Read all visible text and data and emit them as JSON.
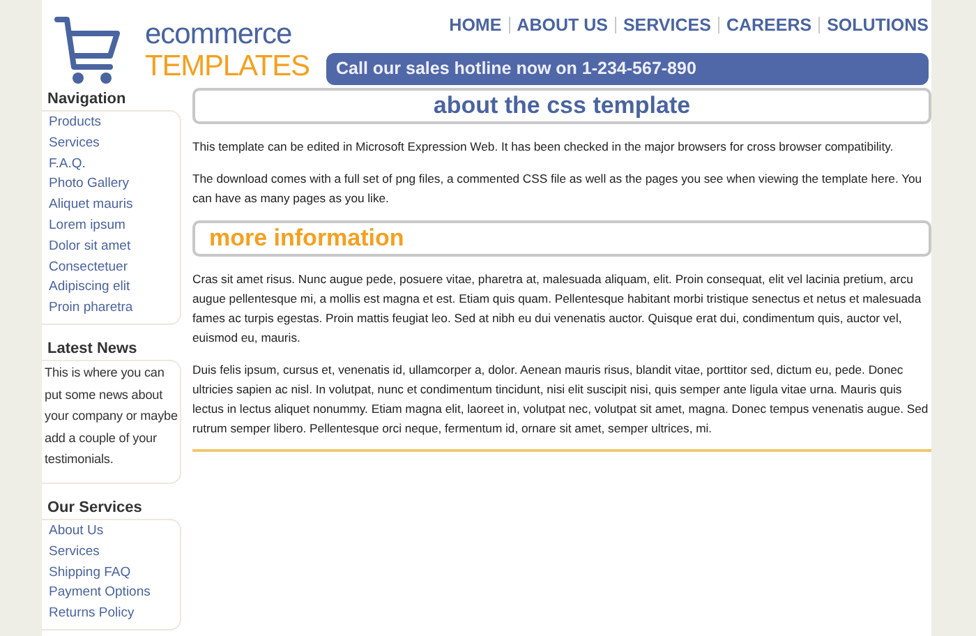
{
  "logo": {
    "line_1": "ecommerce",
    "line_2": "TEMPLATES"
  },
  "top_nav": [
    "HOME",
    "ABOUT US",
    "SERVICES",
    "CAREERS",
    "SOLUTIONS"
  ],
  "hotline": "Call our sales hotline now on 1-234-567-890",
  "sidebar": [
    {
      "kind": "links",
      "title": "Navigation",
      "items": [
        "Products",
        "Services",
        "F.A.Q.",
        "Photo Gallery",
        "Aliquet mauris",
        "Lorem ipsum",
        "Dolor sit amet",
        "Consectetuer",
        "Adipiscing elit",
        "Proin pharetra"
      ]
    },
    {
      "kind": "text",
      "title": "Latest News",
      "text": "This is where you can put some news about your company or maybe add a couple of your testimonials."
    },
    {
      "kind": "links",
      "title": "Our Services",
      "items": [
        "About Us",
        "Services",
        "Shipping FAQ",
        "Payment Options",
        "Returns Policy"
      ]
    }
  ],
  "sections": [
    {
      "kind": "primary",
      "heading": "about the css template",
      "paragraphs": [
        "This template can be edited in Microsoft Expression Web. It has been checked in the major browsers for cross browser compatibility.",
        "The download comes with a full set of png files, a commented CSS file as well as the pages you see when viewing the template here. You can have as many pages as you like."
      ]
    },
    {
      "kind": "secondary",
      "heading": "more information",
      "paragraphs": [
        "Cras sit amet risus. Nunc augue pede, posuere vitae, pharetra at, malesuada aliquam, elit. Proin consequat, elit vel lacinia pretium, arcu augue pellentesque mi, a mollis est magna et est. Etiam quis quam. Pellentesque habitant morbi tristique senectus et netus et malesuada fames ac turpis egestas. Proin mattis feugiat leo. Sed at nibh eu dui venenatis auctor. Quisque erat dui, condimentum quis, auctor vel, euismod eu, mauris.",
        "Duis felis ipsum, cursus et, venenatis id, ullamcorper a, dolor. Aenean mauris risus, blandit vitae, porttitor sed, dictum eu, pede. Donec ultricies sapien ac nisl. In volutpat, nunc et condimentum tincidunt, nisi elit suscipit nisi, quis semper ante ligula vitae urna. Mauris quis lectus in lectus aliquet nonummy. Etiam magna elit, laoreet in, volutpat nec, volutpat sit amet, magna. Donec tempus venenatis augue. Sed rutrum semper libero. Pellentesque orci neque, fermentum id, ornare sit amet, semper ultrices, mi."
      ]
    }
  ]
}
